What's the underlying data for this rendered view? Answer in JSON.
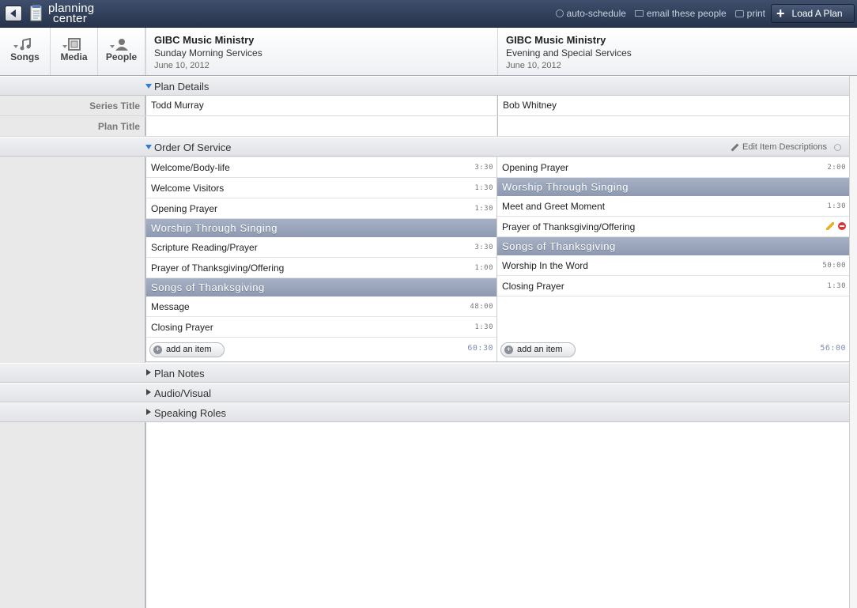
{
  "topbar": {
    "logo_line1": "planning",
    "logo_line2": "center",
    "actions": [
      "auto-schedule",
      "email these people",
      "print"
    ],
    "load_plan": "Load A Plan"
  },
  "nav": [
    {
      "label": "Songs",
      "icon": "music-note-icon"
    },
    {
      "label": "Media",
      "icon": "film-icon"
    },
    {
      "label": "People",
      "icon": "person-icon"
    }
  ],
  "plans": [
    {
      "org": "GIBC Music Ministry",
      "service": "Sunday Morning Services",
      "date": "June 10, 2012"
    },
    {
      "org": "GIBC Music Ministry",
      "service": "Evening and Special Services",
      "date": "June 10, 2012"
    }
  ],
  "sections": {
    "plan_details": "Plan Details",
    "order_of_service": "Order Of Service",
    "edit_item_descriptions": "Edit Item Descriptions",
    "plan_notes": "Plan Notes",
    "audio_visual": "Audio/Visual",
    "speaking_roles": "Speaking Roles"
  },
  "details": {
    "series_title_label": "Series Title",
    "plan_title_label": "Plan Title",
    "series_titles": [
      "Todd Murray",
      "Bob Whitney"
    ],
    "plan_titles": [
      "",
      ""
    ]
  },
  "order": [
    {
      "items": [
        {
          "type": "item",
          "title": "Welcome/Body-life",
          "length": "3:30"
        },
        {
          "type": "item",
          "title": "Welcome Visitors",
          "length": "1:30"
        },
        {
          "type": "item",
          "title": "Opening Prayer",
          "length": "1:30"
        },
        {
          "type": "header",
          "title": "Worship Through Singing"
        },
        {
          "type": "item",
          "title": "Scripture Reading/Prayer",
          "length": "3:30"
        },
        {
          "type": "item",
          "title": "Prayer of Thanksgiving/Offering",
          "length": "1:00"
        },
        {
          "type": "header",
          "title": "Songs of Thanksgiving"
        },
        {
          "type": "item",
          "title": "Message",
          "length": "48:00"
        },
        {
          "type": "item",
          "title": "Closing Prayer",
          "length": "1:30"
        }
      ],
      "add_label": "add an item",
      "total": "60:30"
    },
    {
      "items": [
        {
          "type": "item",
          "title": "Opening Prayer",
          "length": "2:00"
        },
        {
          "type": "header",
          "title": "Worship Through Singing"
        },
        {
          "type": "item",
          "title": "Meet and Greet Moment",
          "length": "1:30"
        },
        {
          "type": "item",
          "title": "Prayer of Thanksgiving/Offering",
          "length": "",
          "editing": true
        },
        {
          "type": "header",
          "title": "Songs of Thanksgiving"
        },
        {
          "type": "item",
          "title": "Worship In the Word",
          "length": "50:00"
        },
        {
          "type": "item",
          "title": "Closing Prayer",
          "length": "1:30"
        }
      ],
      "add_label": "add an item",
      "total": "56:00"
    }
  ]
}
